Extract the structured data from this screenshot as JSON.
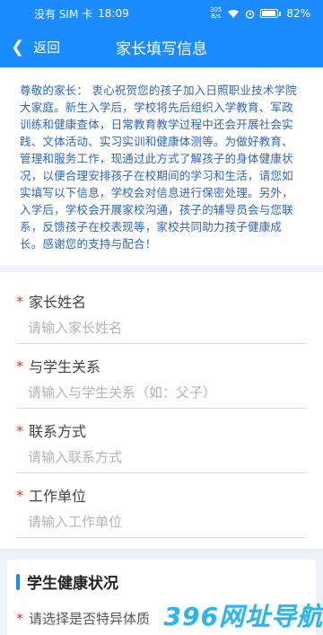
{
  "status_bar": {
    "carrier": "没有 SIM 卡",
    "time": "18:09",
    "net_speed_top": "305",
    "net_speed_bottom": "B/s",
    "battery": "82%"
  },
  "header": {
    "back_label": "返回",
    "title": "家长填写信息"
  },
  "notice": {
    "text": "尊敬的家长：  衷心祝贺您的孩子加入日照职业技术学院大家庭。新生入学后，学校将先后组织入学教育、军政训练和健康查体，日常教育教学过程中还会开展社会实践、文体活动、实习实训和健康体测等。为做好教育、管理和服务工作，现通过此方式了解孩子的身体健康状况，以便合理安排孩子在校期间的学习和生活，请您如实填写以下信息，学校会对信息进行保密处理。另外，入学后，学校会开展家校沟通，孩子的辅导员会与您联系，反馈孩子在校表现等，家校共同助力孩子健康成长。感谢您的支持与配合！"
  },
  "form": {
    "fields": [
      {
        "label": "家长姓名",
        "placeholder": "请输入家长姓名"
      },
      {
        "label": "与学生关系",
        "placeholder": "请输入与学生关系（如：父子）"
      },
      {
        "label": "联系方式",
        "placeholder": "请输入联系方式"
      },
      {
        "label": "工作单位",
        "placeholder": "请输入工作单位"
      }
    ],
    "required_mark": "*"
  },
  "health_section": {
    "title": "学生健康状况",
    "first_field": "请选择是否特异体质"
  },
  "watermark": "396网址导航",
  "colors": {
    "primary": "#1a8cff",
    "notice_text": "#2f67b8",
    "required": "#d9362b",
    "watermark": "#2fb3ee"
  }
}
